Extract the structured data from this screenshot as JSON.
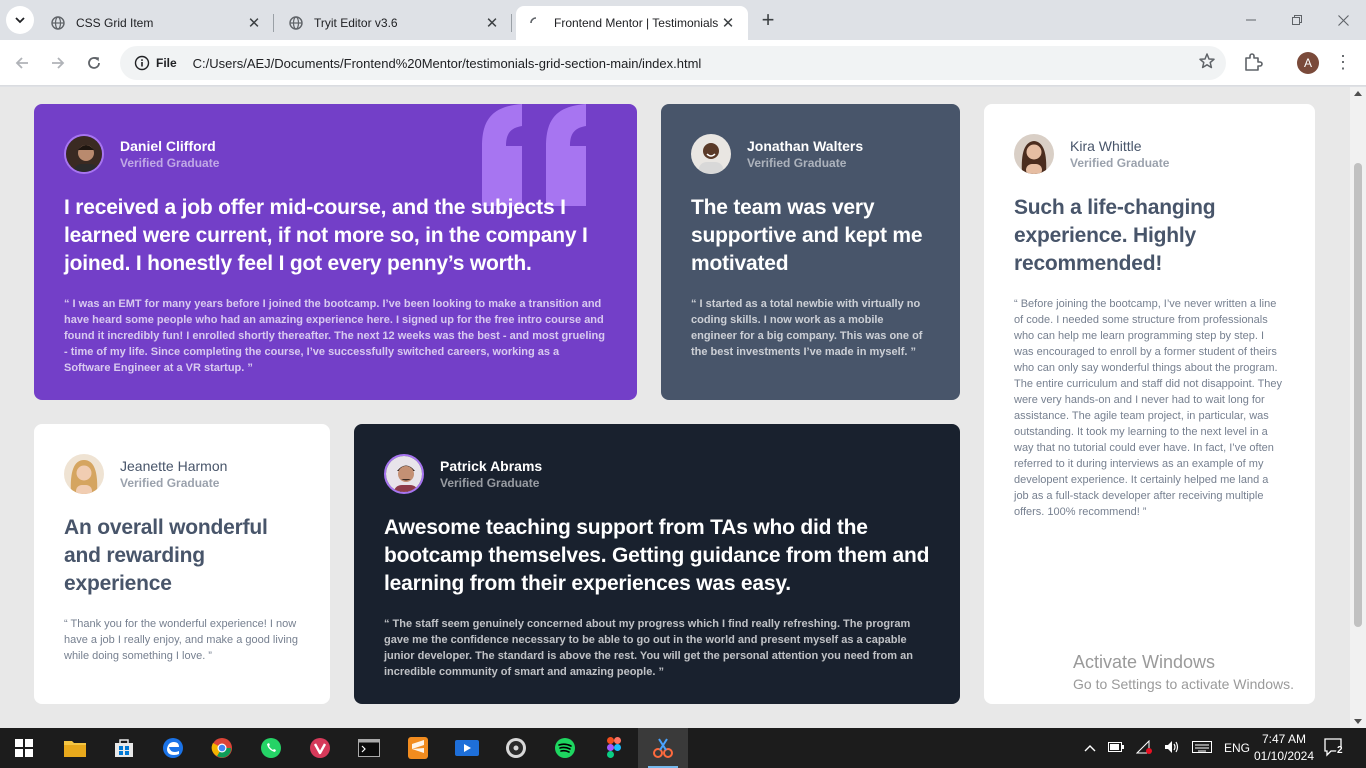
{
  "browser": {
    "tabs": [
      {
        "title": "CSS Grid Item",
        "active": false
      },
      {
        "title": "Tryit Editor v3.6",
        "active": false
      },
      {
        "title": "Frontend Mentor | Testimonials",
        "active": true
      }
    ],
    "site_info_label": "File",
    "url": "C:/Users/AEJ/Documents/Frontend%20Mentor/testimonials-grid-section-main/index.html",
    "profile_initial": "A"
  },
  "testimonials": [
    {
      "name": "Daniel Clifford",
      "role": "Verified Graduate",
      "headline": "I received a job offer mid-course, and the subjects I learned were current, if not more so, in the company I joined. I honestly feel I got every penny’s worth.",
      "quote": "“ I was an EMT for many years before I joined the bootcamp. I’ve been looking to make a transition and have heard some people who had an amazing experience here. I signed up for the free intro course and found it incredibly fun! I enrolled shortly thereafter. The next 12 weeks was the best - and most grueling - time of my life. Since completing the course, I’ve successfully switched careers, working as a Software Engineer at a VR startup. ”"
    },
    {
      "name": "Jonathan Walters",
      "role": "Verified Graduate",
      "headline": "The team was very supportive and kept me motivated",
      "quote": "“ I started as a total newbie with virtually no coding skills. I now work as a mobile engineer for a big company. This was one of the best investments I’ve made in myself. ”"
    },
    {
      "name": "Kira Whittle",
      "role": "Verified Graduate",
      "headline": "Such a life-changing experience. Highly recommended!",
      "quote": "“ Before joining the bootcamp, I’ve never written a line of code. I needed some structure from professionals who can help me learn programming step by step. I was encouraged to enroll by a former student of theirs who can only say wonderful things about the program. The entire curriculum and staff did not disappoint. They were very hands-on and I never had to wait long for assistance. The agile team project, in particular, was outstanding. It took my learning to the next level in a way that no tutorial could ever have. In fact, I’ve often referred to it during interviews as an example of my developent experience. It certainly helped me land a job as a full-stack developer after receiving multiple offers. 100% recommend! ”"
    },
    {
      "name": "Jeanette Harmon",
      "role": "Verified Graduate",
      "headline": "An overall wonderful and rewarding experience",
      "quote": "“ Thank you for the wonderful experience! I now have a job I really enjoy, and make a good living while doing something I love. ”"
    },
    {
      "name": "Patrick Abrams",
      "role": "Verified Graduate",
      "headline": "Awesome teaching support from TAs who did the bootcamp themselves. Getting guidance from them and learning from their experiences was easy.",
      "quote": "“ The staff seem genuinely concerned about my progress which I find really refreshing. The program gave me the confidence necessary to be able to go out in the world and present myself as a capable junior developer. The standard is above the rest. You will get the personal attention you need from an incredible community of smart and amazing people. ”"
    }
  ],
  "watermark": {
    "line1": "Activate Windows",
    "line2": "Go to Settings to activate Windows."
  },
  "taskbar": {
    "language": "ENG",
    "time": "7:47 AM",
    "date": "01/10/2024",
    "notification_count": "2"
  },
  "colors": {
    "violet": "#733fc8",
    "grayish_blue": "#48556a",
    "dark_blue": "#19212e",
    "white": "#ffffff",
    "page_bg": "#e8e8e8"
  }
}
